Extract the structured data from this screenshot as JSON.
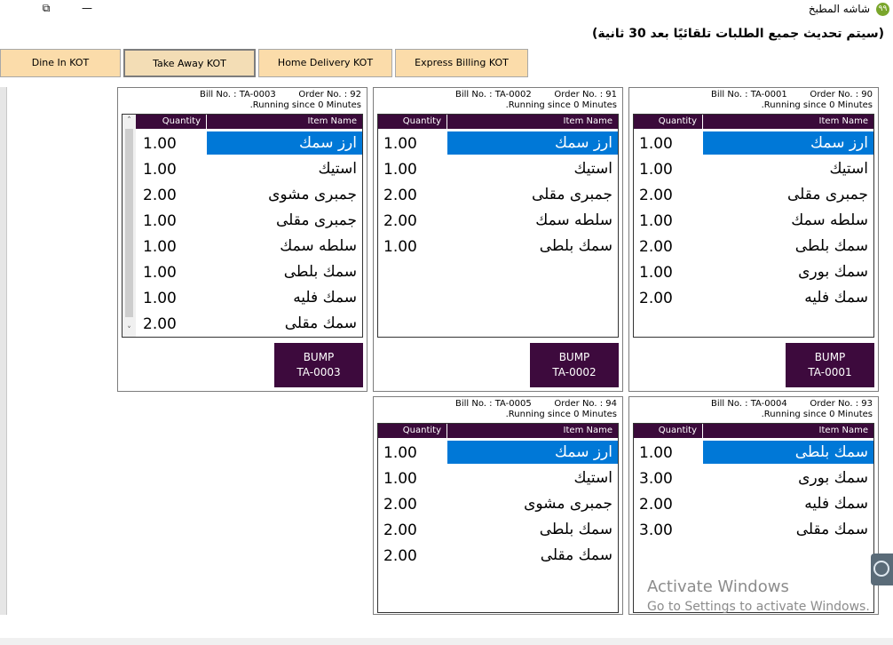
{
  "window": {
    "title": "شاشه المطبخ",
    "app_icon": "٩٩",
    "minimize": "—",
    "restore": "⧉",
    "close": ""
  },
  "notice": "(سيتم تحديث جميع الطلبات تلقائيًا بعد 30 ثانية)",
  "tabs": [
    {
      "label": "Dine In KOT",
      "active": false
    },
    {
      "label": "Take Away KOT",
      "active": true
    },
    {
      "label": "Home Delivery KOT",
      "active": false
    },
    {
      "label": "Express Billing KOT",
      "active": false
    }
  ],
  "headers": {
    "quantity": "Quantity",
    "item_name": "Item Name"
  },
  "orders": [
    {
      "bill_label": "Bill No. : TA-0001",
      "order_label": "Order No. : 90",
      "running": "Running since 0 Minutes.",
      "items": [
        {
          "qty": "1.00",
          "name": "ارز سمك"
        },
        {
          "qty": "1.00",
          "name": "استيك"
        },
        {
          "qty": "2.00",
          "name": "جمبرى مقلى"
        },
        {
          "qty": "1.00",
          "name": "سلطه سمك"
        },
        {
          "qty": "2.00",
          "name": "سمك بلطى"
        },
        {
          "qty": "1.00",
          "name": "سمك بورى"
        },
        {
          "qty": "2.00",
          "name": "سمك فليه"
        }
      ],
      "bump_label": "BUMP",
      "bump_bill": "TA-0001"
    },
    {
      "bill_label": "Bill No. : TA-0002",
      "order_label": "Order No. : 91",
      "running": "Running since 0 Minutes.",
      "items": [
        {
          "qty": "1.00",
          "name": "ارز سمك"
        },
        {
          "qty": "1.00",
          "name": "استيك"
        },
        {
          "qty": "2.00",
          "name": "جمبرى مقلى"
        },
        {
          "qty": "2.00",
          "name": "سلطه سمك"
        },
        {
          "qty": "1.00",
          "name": "سمك بلطى"
        }
      ],
      "bump_label": "BUMP",
      "bump_bill": "TA-0002"
    },
    {
      "bill_label": "Bill No. : TA-0003",
      "order_label": "Order No. : 92",
      "running": "Running since 0 Minutes.",
      "items": [
        {
          "qty": "1.00",
          "name": "ارز سمك"
        },
        {
          "qty": "1.00",
          "name": "استيك"
        },
        {
          "qty": "2.00",
          "name": "جمبرى مشوى"
        },
        {
          "qty": "1.00",
          "name": "جمبرى مقلى"
        },
        {
          "qty": "1.00",
          "name": "سلطه سمك"
        },
        {
          "qty": "1.00",
          "name": "سمك بلطى"
        },
        {
          "qty": "1.00",
          "name": "سمك فليه"
        },
        {
          "qty": "2.00",
          "name": "سمك مقلى"
        }
      ],
      "bump_label": "BUMP",
      "bump_bill": "TA-0003"
    },
    {
      "bill_label": "Bill No. : TA-0004",
      "order_label": "Order No. : 93",
      "running": "Running since 0 Minutes.",
      "items": [
        {
          "qty": "1.00",
          "name": "سمك بلطى"
        },
        {
          "qty": "3.00",
          "name": "سمك بورى"
        },
        {
          "qty": "2.00",
          "name": "سمك فليه"
        },
        {
          "qty": "3.00",
          "name": "سمك مقلى"
        }
      ]
    },
    {
      "bill_label": "Bill No. : TA-0005",
      "order_label": "Order No. : 94",
      "running": "Running since 0 Minutes.",
      "items": [
        {
          "qty": "1.00",
          "name": "ارز سمك"
        },
        {
          "qty": "1.00",
          "name": "استيك"
        },
        {
          "qty": "2.00",
          "name": "جمبرى مشوى"
        },
        {
          "qty": "2.00",
          "name": "سمك بلطى"
        },
        {
          "qty": "2.00",
          "name": "سمك مقلى"
        }
      ]
    }
  ],
  "watermark": {
    "line1": "Activate Windows",
    "line2": "Go to Settings to activate Windows."
  },
  "colors": {
    "header_bg": "#3a0a3a",
    "selected_row": "#0078d7",
    "bump_bg": "#3d0a3d",
    "tab_bg": "#fbdcaa"
  },
  "icons": {
    "teamviewer": "teamviewer-icon",
    "scroll_up": "˄",
    "scroll_down": "˅"
  }
}
